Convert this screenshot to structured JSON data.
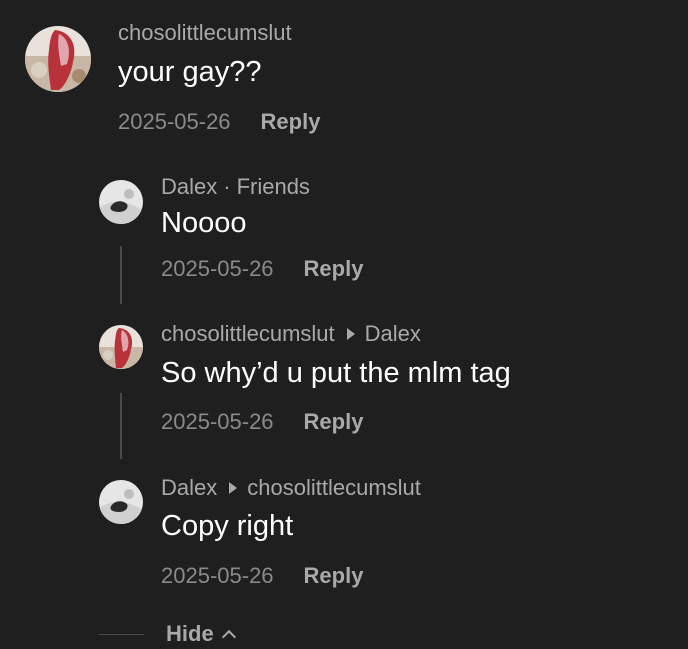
{
  "comments": [
    {
      "author": "chosolittlecumslut",
      "body": "your gay??",
      "date": "2025-05-26",
      "reply": "Reply"
    },
    {
      "author": "Dalex",
      "separator": "·",
      "tag": "Friends",
      "body": "Noooo",
      "date": "2025-05-26",
      "reply": "Reply"
    },
    {
      "author": "chosolittlecumslut",
      "reply_to": "Dalex",
      "body": "So why’d u put the mlm tag",
      "date": "2025-05-26",
      "reply": "Reply"
    },
    {
      "author": "Dalex",
      "reply_to": "chosolittlecumslut",
      "body": "Copy right",
      "date": "2025-05-26",
      "reply": "Reply"
    }
  ],
  "hide_label": "Hide",
  "colors": {
    "background": "#1f1f1f",
    "text": "#ffffff",
    "meta": "#a9a9a9",
    "date": "#8a8a8a"
  }
}
